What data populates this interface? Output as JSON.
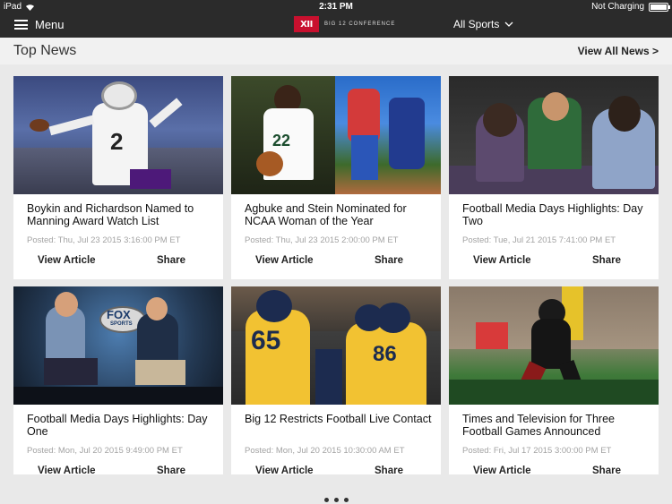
{
  "status_bar": {
    "device": "iPad",
    "time": "2:31 PM",
    "battery_text": "Not Charging"
  },
  "header": {
    "menu_label": "Menu",
    "logo_mark": "XII",
    "logo_text": "BIG 12 CONFERENCE",
    "sports_filter": "All Sports"
  },
  "section": {
    "title": "Top News",
    "view_all": "View All News >"
  },
  "articles": [
    {
      "headline": "Boykin and Richardson Named to Manning Award Watch List",
      "posted": "Posted: Thu, Jul 23 2015 3:16:00 PM ET",
      "view_label": "View Article",
      "share_label": "Share"
    },
    {
      "headline": "Agbuke and Stein Nominated for NCAA Woman of the Year",
      "posted": "Posted: Thu, Jul 23 2015 2:00:00 PM ET",
      "view_label": "View Article",
      "share_label": "Share"
    },
    {
      "headline": "Football Media Days Highlights: Day Two",
      "posted": "Posted: Tue, Jul 21 2015 7:41:00 PM ET",
      "view_label": "View Article",
      "share_label": "Share"
    },
    {
      "headline": "Football Media Days Highlights: Day One",
      "posted": "Posted: Mon, Jul 20 2015 9:49:00 PM ET",
      "view_label": "View Article",
      "share_label": "Share"
    },
    {
      "headline": "Big 12 Restricts Football Live Contact",
      "posted": "Posted: Mon, Jul 20 2015 10:30:00 AM ET",
      "view_label": "View Article",
      "share_label": "Share"
    },
    {
      "headline": "Times and Television for Three Football Games Announced",
      "posted": "Posted: Fri, Jul 17 2015 3:00:00 PM ET",
      "view_label": "View Article",
      "share_label": "Share"
    }
  ],
  "image_text": {
    "jersey_tcu": "2",
    "jersey_baylor": "22",
    "fox": "FOX",
    "fox_sub": "SPORTS",
    "wv_num1": "65",
    "wv_num2": "86"
  },
  "pagination": {
    "pages": 3
  }
}
